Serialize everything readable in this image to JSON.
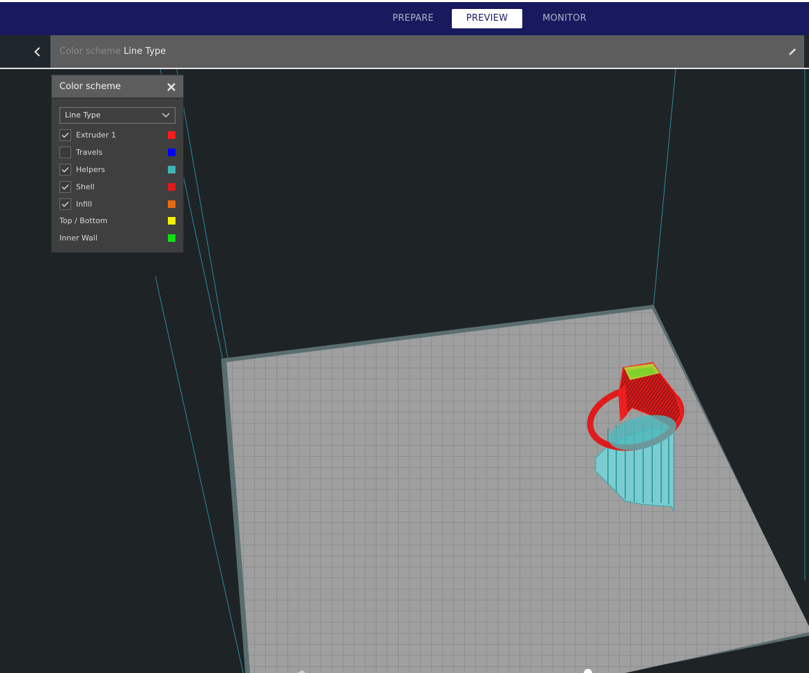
{
  "stages": [
    {
      "label": "PREPARE",
      "active": false
    },
    {
      "label": "PREVIEW",
      "active": true
    },
    {
      "label": "MONITOR",
      "active": false
    }
  ],
  "header": {
    "scheme_label": "Color scheme",
    "scheme_value": "Line Type"
  },
  "panel": {
    "title": "Color scheme",
    "dropdown": "Line Type",
    "items": [
      {
        "label": "Extruder 1",
        "checked": true,
        "has_checkbox": true,
        "color": "#ff1a1a"
      },
      {
        "label": "Travels",
        "checked": false,
        "has_checkbox": true,
        "color": "#0000ff"
      },
      {
        "label": "Helpers",
        "checked": true,
        "has_checkbox": true,
        "color": "#3fb4b4"
      },
      {
        "label": "Shell",
        "checked": true,
        "has_checkbox": true,
        "color": "#e01b1b"
      },
      {
        "label": "Infill",
        "checked": true,
        "has_checkbox": true,
        "color": "#e86a14"
      },
      {
        "label": "Top / Bottom",
        "checked": false,
        "has_checkbox": false,
        "color": "#f2f200"
      },
      {
        "label": "Inner Wall",
        "checked": false,
        "has_checkbox": false,
        "color": "#11dd11"
      }
    ]
  },
  "colors": {
    "topbar": "#19195e",
    "background": "#1e2326",
    "bed": "#9e9e9e",
    "bed_border": "#4f6466",
    "volume_lines": "#2b8ba2",
    "model_shell": "#e01b1b",
    "model_helpers": "#6fdce0"
  }
}
